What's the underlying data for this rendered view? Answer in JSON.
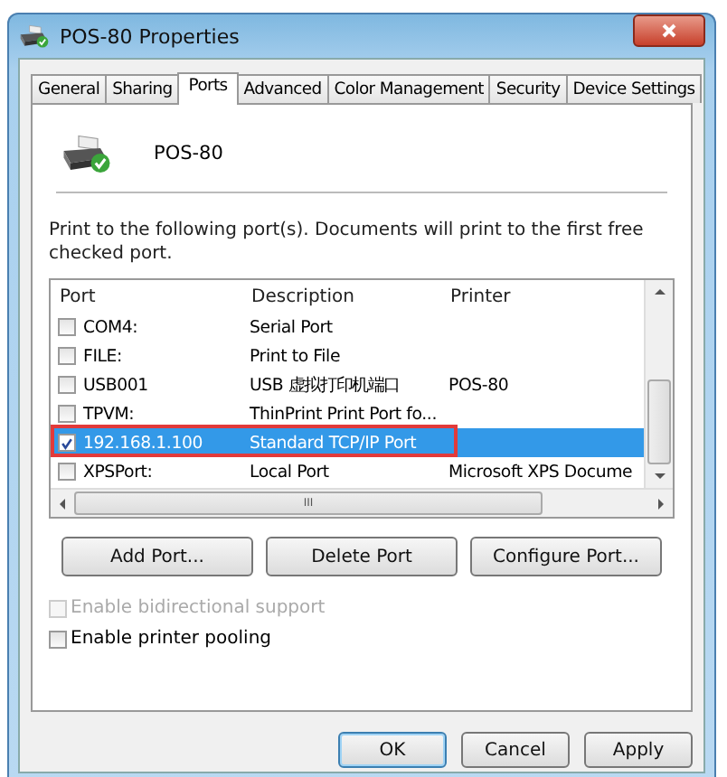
{
  "window": {
    "title": "POS-80 Properties"
  },
  "tabs": [
    {
      "label": "General",
      "selected": false
    },
    {
      "label": "Sharing",
      "selected": false
    },
    {
      "label": "Ports",
      "selected": true
    },
    {
      "label": "Advanced",
      "selected": false
    },
    {
      "label": "Color Management",
      "selected": false
    },
    {
      "label": "Security",
      "selected": false
    },
    {
      "label": "Device Settings",
      "selected": false
    }
  ],
  "printer_name": "POS-80",
  "instructions": "Print to the following port(s). Documents will print to the first free checked port.",
  "ports_table": {
    "columns": [
      "Port",
      "Description",
      "Printer"
    ],
    "rows": [
      {
        "port": "COM4:",
        "description": "Serial Port",
        "printer": "",
        "checked": false,
        "selected": false,
        "outlined": false
      },
      {
        "port": "FILE:",
        "description": "Print to File",
        "printer": "",
        "checked": false,
        "selected": false,
        "outlined": false
      },
      {
        "port": "USB001",
        "description": "USB 虚拟打印机端口",
        "printer": "POS-80",
        "checked": false,
        "selected": false,
        "outlined": false
      },
      {
        "port": "TPVM:",
        "description": "ThinPrint Print Port fo...",
        "printer": "",
        "checked": false,
        "selected": false,
        "outlined": false
      },
      {
        "port": "192.168.1.100",
        "description": "Standard TCP/IP Port",
        "printer": "",
        "checked": true,
        "selected": true,
        "outlined": true
      },
      {
        "port": "XPSPort:",
        "description": "Local Port",
        "printer": "Microsoft XPS Docume",
        "checked": false,
        "selected": false,
        "outlined": false
      }
    ],
    "scroll_mark": "III"
  },
  "port_buttons": [
    "Add Port...",
    "Delete Port",
    "Configure Port..."
  ],
  "options": [
    {
      "label": "Enable bidirectional support",
      "checked": false,
      "disabled": true
    },
    {
      "label": "Enable printer pooling",
      "checked": false,
      "disabled": false
    }
  ],
  "dialog_buttons": [
    "OK",
    "Cancel",
    "Apply"
  ]
}
